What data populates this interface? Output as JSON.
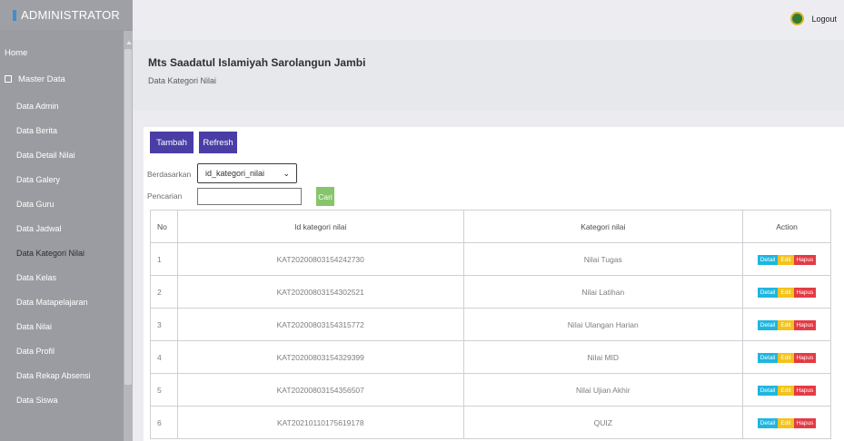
{
  "brand": "ADMINISTRATOR",
  "topbar": {
    "logout_label": "Logout"
  },
  "sidebar": {
    "home": "Home",
    "master": "Master Data",
    "items": [
      "Data Admin",
      "Data Berita",
      "Data Detail Nilai",
      "Data Galery",
      "Data Guru",
      "Data Jadwal",
      "Data Kategori Nilai",
      "Data Kelas",
      "Data Matapelajaran",
      "Data Nilai",
      "Data Profil",
      "Data Rekap Absensi",
      "Data Siswa"
    ],
    "active_item": "Data Kategori Nilai"
  },
  "header": {
    "title": "Mts Saadatul Islamiyah Sarolangun Jambi",
    "subtitle": "Data Kategori Nilai"
  },
  "toolbar": {
    "tambah": "Tambah",
    "refresh": "Refresh"
  },
  "filter": {
    "by_label": "Berdasarkan",
    "by_value": "id_kategori_nilai",
    "search_label": "Pencarian",
    "search_value": "",
    "search_button": "Cari"
  },
  "table": {
    "headers": [
      "No",
      "Id kategori nilai",
      "Kategori nilai",
      "Action"
    ],
    "action_labels": {
      "detail": "Detail",
      "edit": "Edit",
      "hapus": "Hapus"
    },
    "rows": [
      {
        "no": "1",
        "id": "KAT20200803154242730",
        "kategori": "Nilai Tugas"
      },
      {
        "no": "2",
        "id": "KAT20200803154302521",
        "kategori": "Nilai Latihan"
      },
      {
        "no": "3",
        "id": "KAT20200803154315772",
        "kategori": "Nilai Ulangan Harian"
      },
      {
        "no": "4",
        "id": "KAT20200803154329399",
        "kategori": "Nilai MID"
      },
      {
        "no": "5",
        "id": "KAT20200803154356507",
        "kategori": "Nilai Ujian Akhir"
      },
      {
        "no": "6",
        "id": "KAT20210110175619178",
        "kategori": "QUIZ"
      }
    ]
  }
}
